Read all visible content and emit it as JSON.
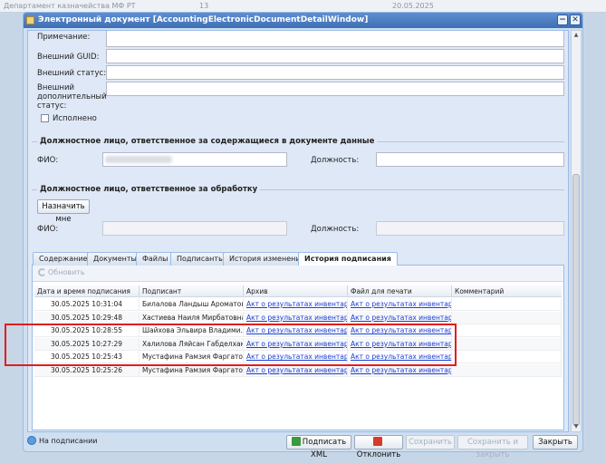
{
  "background": {
    "department": "Департамент казначейства МФ РТ",
    "number": "13",
    "date": "20.05.2025"
  },
  "window": {
    "title": "Электронный документ [AccountingElectronicDocumentDetailWindow]",
    "buttons": [
      "minimize",
      "close"
    ]
  },
  "form": {
    "note_label": "Примечание:",
    "external_guid_label": "Внешний GUID:",
    "external_status_label": "Внешний статус:",
    "external_additional_status_label": "Внешний дополнительный статус:",
    "executed_label": "Исполнено",
    "executed_checked": false
  },
  "responsible_content": {
    "legend": "Должностное лицо, ответственное за содержащиеся в документе данные",
    "fio_label": "ФИО:",
    "fio_value": "",
    "position_label": "Должность:",
    "position_value": ""
  },
  "responsible_processing": {
    "legend": "Должностное лицо, ответственное за обработку",
    "assign_button": "Назначить мне",
    "fio_label": "ФИО:",
    "position_label": "Должность:"
  },
  "tabs": [
    {
      "label": "Содержание",
      "active": false
    },
    {
      "label": "Документы",
      "active": false
    },
    {
      "label": "Файлы",
      "active": false
    },
    {
      "label": "Подписанты",
      "active": false
    },
    {
      "label": "История изменений",
      "active": false
    },
    {
      "label": "История подписания",
      "active": true
    }
  ],
  "toolbar": {
    "refresh_label": "Обновить"
  },
  "grid": {
    "columns": [
      "Дата и время подписания",
      "Подписант",
      "Архив",
      "Файл для печати",
      "Комментарий"
    ],
    "rows": [
      {
        "datetime": "30.05.2025 10:31:04",
        "signer": "Билалова Ландыш Ароматов...",
        "archive": "Акт о результатах инвентар...",
        "print_file": "Акт о результатах инвентар...",
        "comment": ""
      },
      {
        "datetime": "30.05.2025 10:29:48",
        "signer": "Хастиева Наиля Мирбатовна",
        "archive": "Акт о результатах инвентар...",
        "print_file": "Акт о результатах инвентар...",
        "comment": ""
      },
      {
        "datetime": "30.05.2025 10:28:55",
        "signer": "Шайхова Эльвира Владими...",
        "archive": "Акт о результатах инвентар...",
        "print_file": "Акт о результатах инвентар...",
        "comment": ""
      },
      {
        "datetime": "30.05.2025 10:27:29",
        "signer": "Халилова Ляйсан Габделхак...",
        "archive": "Акт о результатах инвентар...",
        "print_file": "Акт о результатах инвентар...",
        "comment": ""
      },
      {
        "datetime": "30.05.2025 10:25:43",
        "signer": "Мустафина Рамзия Фаргатов...",
        "archive": "Акт о результатах инвентар...",
        "print_file": "Акт о результатах инвентар...",
        "comment": ""
      },
      {
        "datetime": "30.05.2025 10:25:26",
        "signer": "Мустафина Рамзия Фаргатов...",
        "archive": "Акт о результатах инвентар...",
        "print_file": "Акт о результатах инвентар...",
        "comment": ""
      }
    ]
  },
  "footer": {
    "status": "На подписании",
    "sign_xml": "Подписать XML",
    "reject": "Отклонить",
    "save": "Сохранить",
    "save_close": "Сохранить и закрыть",
    "close": "Закрыть"
  },
  "colors": {
    "accent": "#3e6fb4",
    "link": "#1b3fd1",
    "highlight": "#e01e1e"
  }
}
